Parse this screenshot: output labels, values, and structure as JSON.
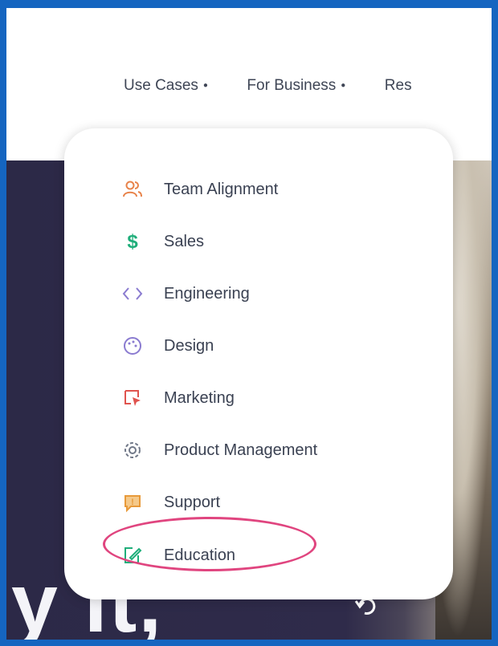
{
  "nav": {
    "items": [
      {
        "label": "Use Cases"
      },
      {
        "label": "For Business"
      },
      {
        "label": "Res"
      }
    ]
  },
  "dropdown": {
    "items": [
      {
        "label": "Team Alignment",
        "icon": "team-icon",
        "color": "#e8834a"
      },
      {
        "label": "Sales",
        "icon": "dollar-icon",
        "color": "#1fae7a"
      },
      {
        "label": "Engineering",
        "icon": "code-icon",
        "color": "#8a7bd0"
      },
      {
        "label": "Design",
        "icon": "palette-icon",
        "color": "#8a7bd0"
      },
      {
        "label": "Marketing",
        "icon": "marketing-icon",
        "color": "#e0534e"
      },
      {
        "label": "Product Management",
        "icon": "gear-icon",
        "color": "#707888"
      },
      {
        "label": "Support",
        "icon": "support-icon",
        "color": "#e89a3a"
      },
      {
        "label": "Education",
        "icon": "edit-icon",
        "color": "#1fae7a"
      }
    ]
  },
  "hero": {
    "text": "y it,"
  },
  "highlight_color": "#e0457f"
}
